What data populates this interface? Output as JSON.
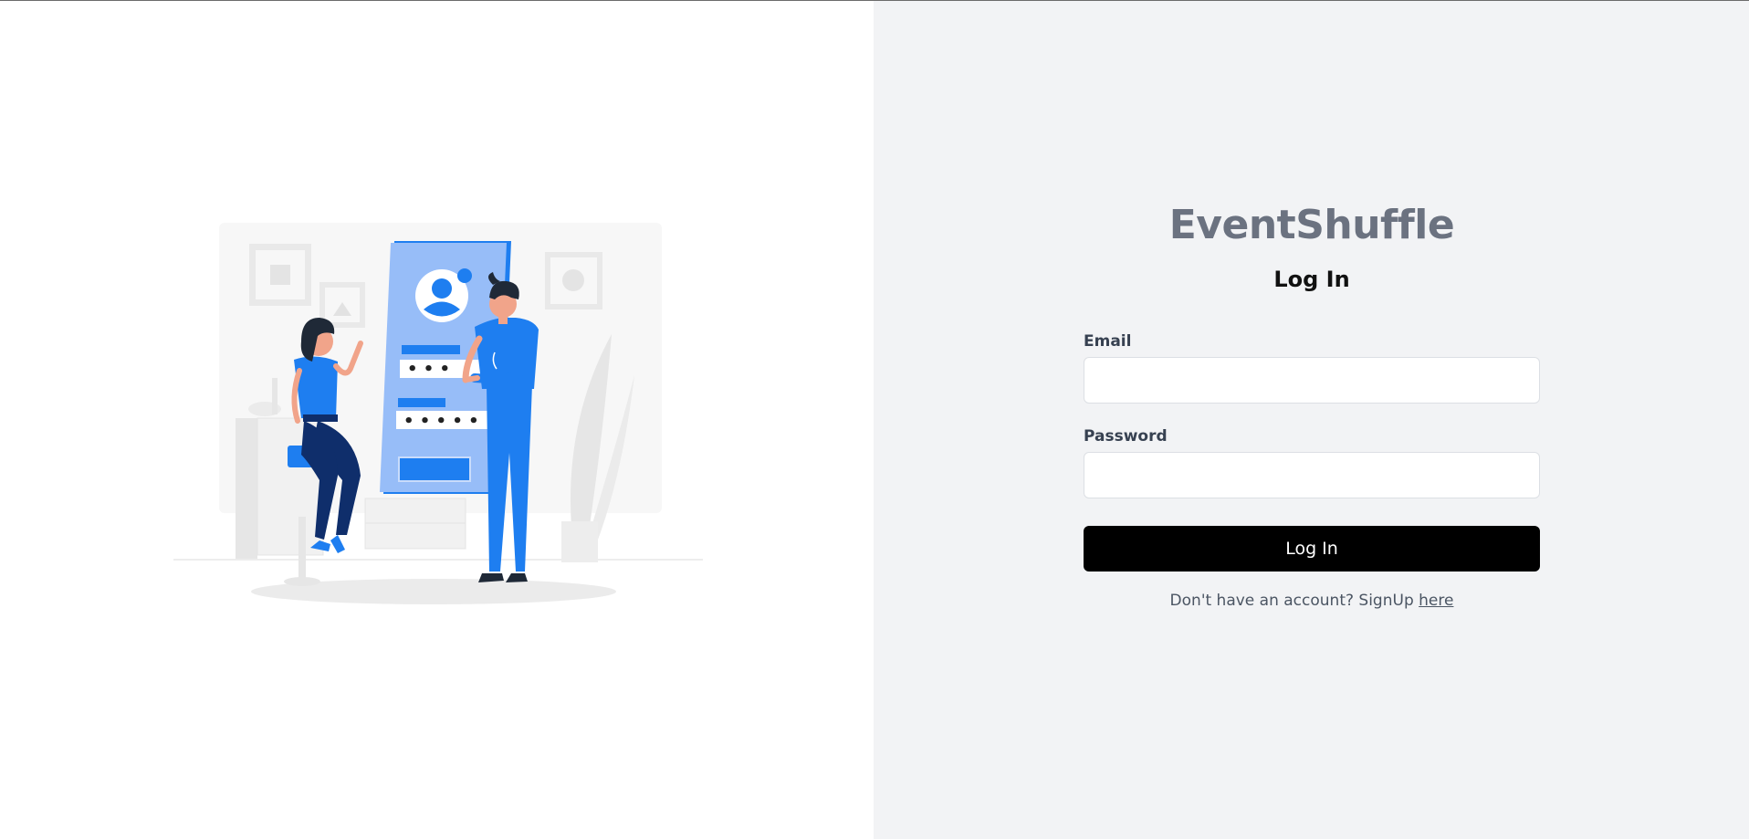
{
  "brand": {
    "name": "EventShuffle"
  },
  "form": {
    "title": "Log In",
    "email": {
      "label": "Email",
      "value": "",
      "placeholder": ""
    },
    "password": {
      "label": "Password",
      "value": "",
      "placeholder": ""
    },
    "submit_label": "Log In",
    "signup_prompt": "Don't have an account? SignUp ",
    "signup_link": "here"
  },
  "illustration": {
    "icon": "login-illustration-icon",
    "password_dots_1": "• • •",
    "password_dots_2": "• • • • •"
  },
  "colors": {
    "left_bg": "#ffffff",
    "right_bg": "#f2f3f5",
    "brand_text": "#6b7280",
    "button_bg": "#000000",
    "accent_blue": "#1e7ef0"
  }
}
